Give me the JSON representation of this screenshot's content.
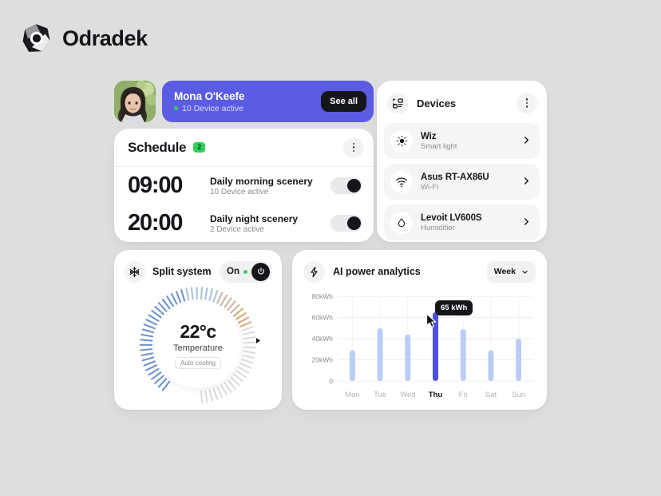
{
  "app": {
    "brand_name": "Odradek",
    "logo_icon": "odradek-hexagon-logo",
    "background_color": "#dedede",
    "accent_color": "#5b5ce2",
    "dark_color": "#15161a",
    "green_color": "#33d45e"
  },
  "profile": {
    "avatar_icon": "user-avatar-photo",
    "name": "Mona O'Keefe",
    "status": "10 Device active",
    "status_dot_color": "#33d45e",
    "see_all_label": "See all",
    "banner_color": "#5b5ce2"
  },
  "schedule": {
    "title": "Schedule",
    "badge": "2",
    "menu_icon": "kebab-menu-icon",
    "rows": [
      {
        "time": "09:00",
        "label": "Daily morning scenery",
        "sub": "10 Device active",
        "toggle_state": "on"
      },
      {
        "time": "20:00",
        "label": "Daily night scenery",
        "sub": "2 Device active",
        "toggle_state": "on"
      }
    ]
  },
  "devices": {
    "title": "Devices",
    "header_icon": "devices-grid-icon",
    "menu_icon": "kebab-menu-icon",
    "items": [
      {
        "name": "Wiz",
        "sub": "Smart light",
        "icon": "brightness-icon",
        "chevron": "chevron-right-icon"
      },
      {
        "name": "Asus RT-AX86U",
        "sub": "Wi-Fi",
        "icon": "wifi-icon",
        "chevron": "chevron-right-icon"
      },
      {
        "name": "Levoit LV600S",
        "sub": "Humidifier",
        "icon": "water-drop-icon",
        "chevron": "chevron-right-icon"
      }
    ]
  },
  "split_system": {
    "title": "Split system",
    "header_icon": "snowflake-icon",
    "power_label": "On",
    "power_dot_color": "#33d45e",
    "power_icon": "power-button-icon",
    "temperature_value": "22°c",
    "temperature_label": "Temperature",
    "mode": "Auto cooling",
    "dial_marker_icon": "dial-marker-triangle"
  },
  "analytics": {
    "title": "AI power analytics",
    "header_icon": "lightning-bolt-icon",
    "range_label": "Week",
    "range_chevron": "chevron-down-icon",
    "tooltip": "65 kWh",
    "cursor_icon": "mouse-cursor-icon",
    "chart_data": {
      "type": "bar",
      "title": "AI power analytics",
      "xlabel": "",
      "ylabel": "kWh",
      "categories": [
        "Mon",
        "Tue",
        "Wed",
        "Thu",
        "Fri",
        "Sat",
        "Sun"
      ],
      "values": [
        29,
        50,
        44,
        65,
        49,
        29,
        40
      ],
      "ylim": [
        0,
        80
      ],
      "ytick_labels": [
        "80kWh",
        "60kWh",
        "40kWh",
        "20kWh",
        "0"
      ],
      "ytick_values": [
        80,
        60,
        40,
        20,
        0
      ],
      "grid": true,
      "legend": false,
      "highlighted_index": 3,
      "highlight_label": "65 kWh",
      "bar_color": "#b9cdf7",
      "highlight_color": "#4d50e0"
    }
  }
}
